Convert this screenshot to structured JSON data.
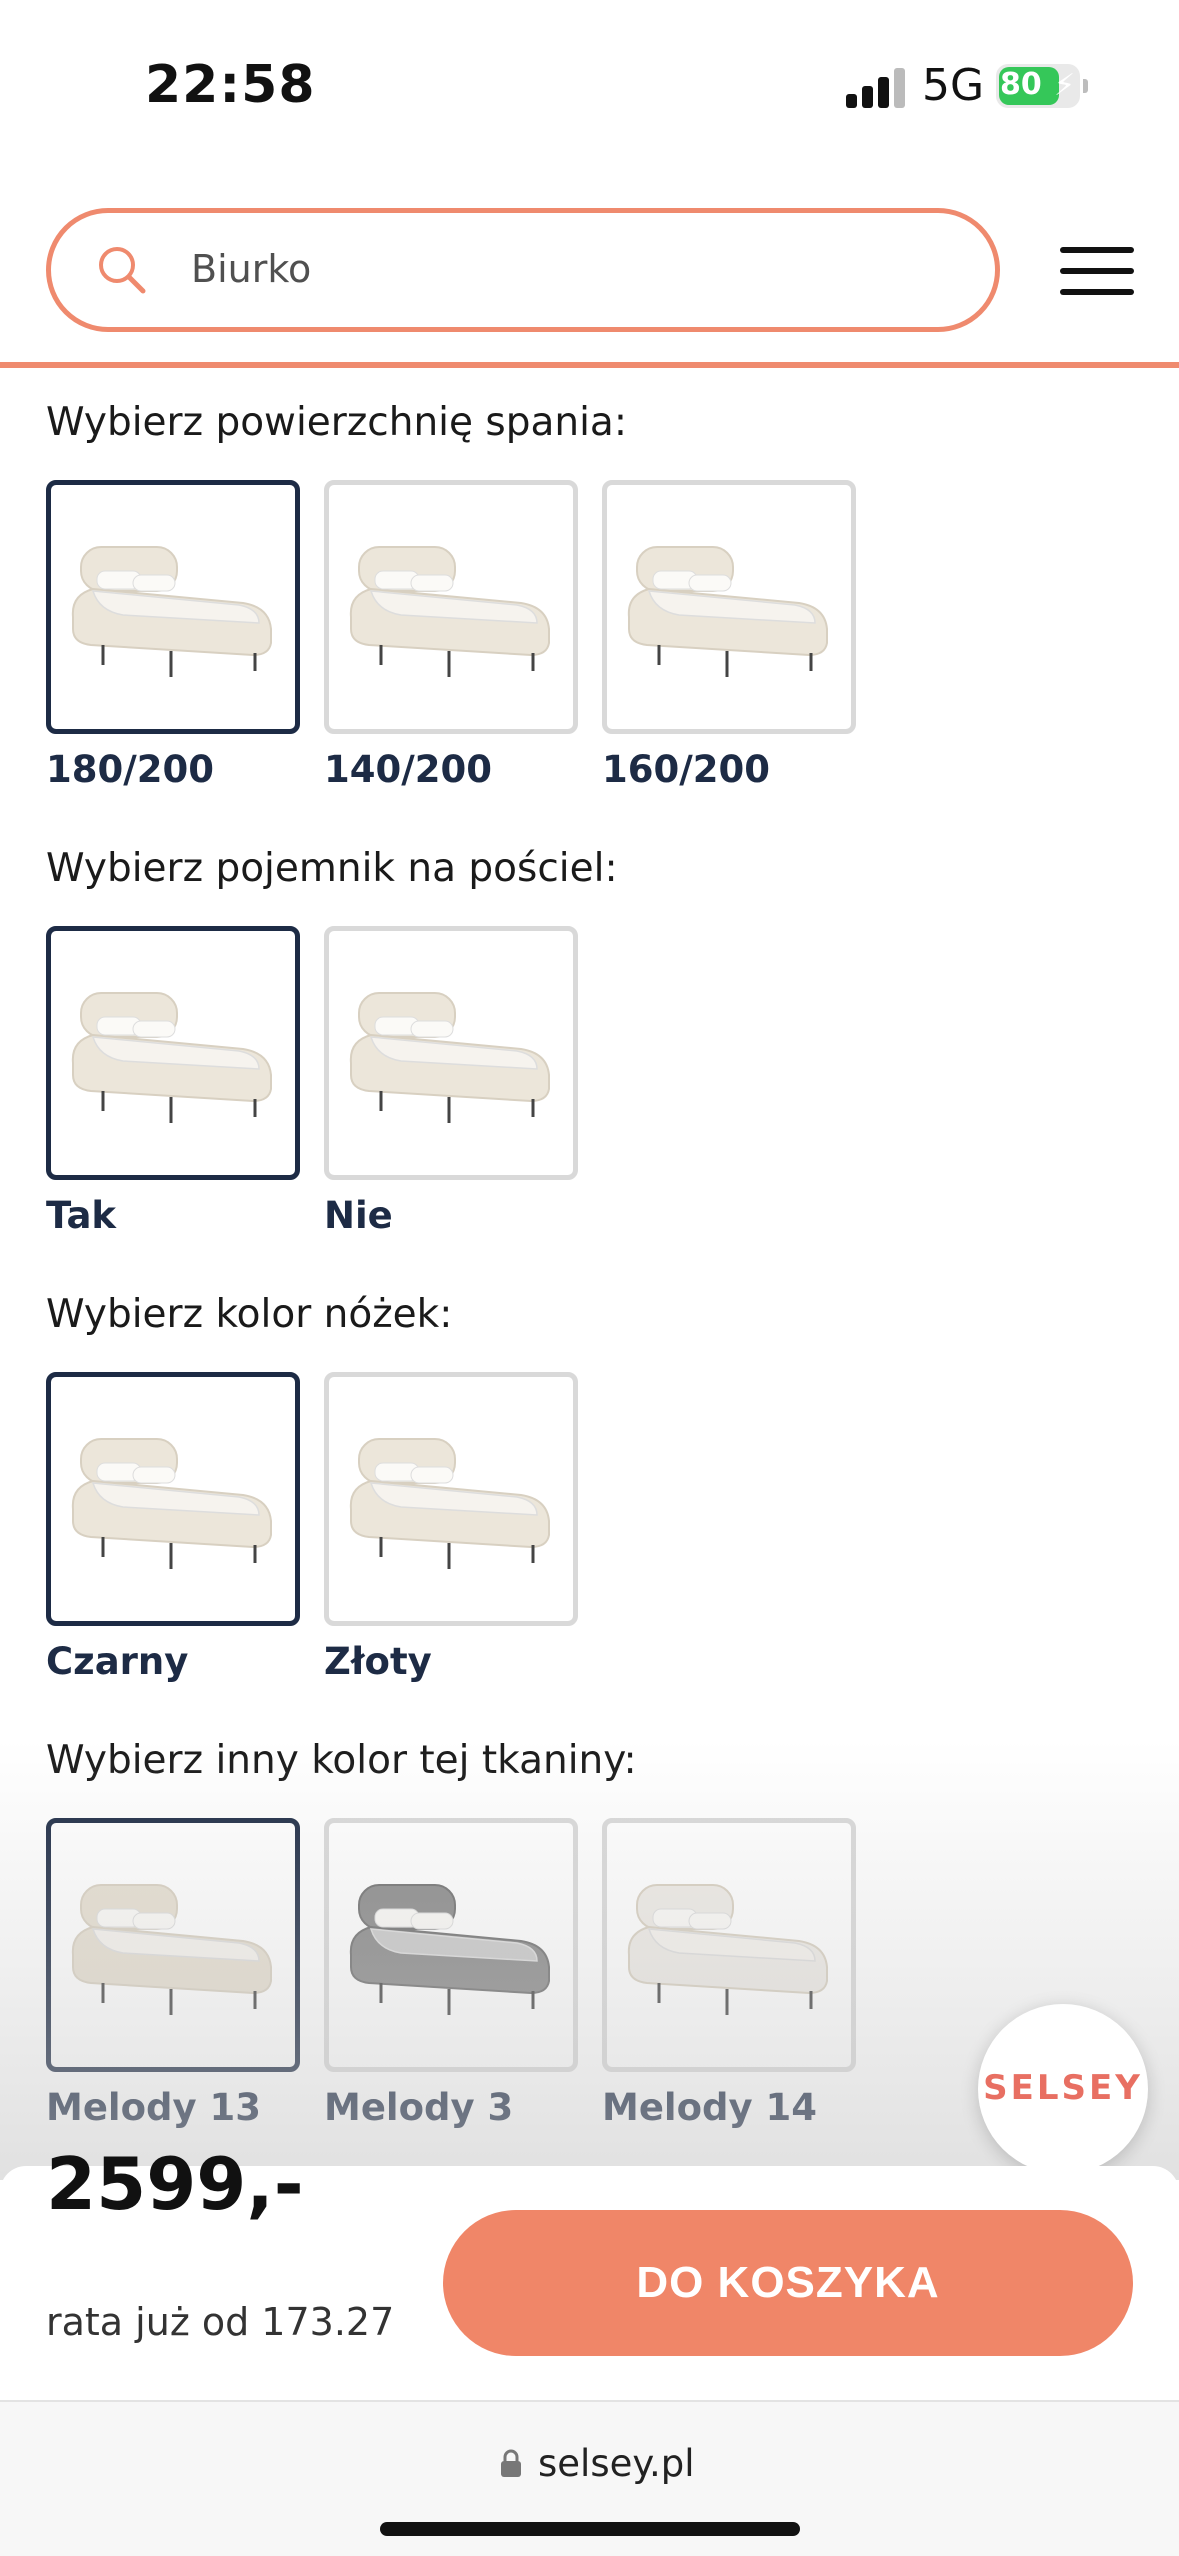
{
  "status": {
    "time": "22:58",
    "network": "5G",
    "battery": "80"
  },
  "header": {
    "search_value": "Biurko",
    "search_icon": "search-icon",
    "menu_icon": "hamburger-menu-icon"
  },
  "sections": [
    {
      "title": "Wybierz powierzchnię spania:",
      "options": [
        {
          "label": "180/200",
          "selected": true,
          "color": "#ece6da"
        },
        {
          "label": "140/200",
          "selected": false,
          "color": "#ece6da"
        },
        {
          "label": "160/200",
          "selected": false,
          "color": "#ece6da"
        }
      ]
    },
    {
      "title": "Wybierz pojemnik na pościel:",
      "options": [
        {
          "label": "Tak",
          "selected": true,
          "color": "#ece6da"
        },
        {
          "label": "Nie",
          "selected": false,
          "color": "#ece6da"
        }
      ]
    },
    {
      "title": "Wybierz kolor nóżek:",
      "options": [
        {
          "label": "Czarny",
          "selected": true,
          "color": "#ece6da"
        },
        {
          "label": "Złoty",
          "selected": false,
          "color": "#ece6da"
        }
      ]
    },
    {
      "title": "Wybierz inny kolor tej tkaniny:",
      "options": [
        {
          "label": "Melody 13",
          "selected": true,
          "color": "#e6dfd1"
        },
        {
          "label": "Melody 3",
          "selected": false,
          "color": "#8a8a8a"
        },
        {
          "label": "Melody 14",
          "selected": false,
          "color": "#eeebe6"
        }
      ]
    }
  ],
  "brand_bubble": "SELSEY",
  "cart": {
    "price": "2599,-",
    "installment": "rata już od 173.27",
    "button_label": "DO KOSZYKA"
  },
  "browser": {
    "url": "selsey.pl"
  },
  "colors": {
    "accent": "#ef8a6e",
    "selected_border": "#1d2b45",
    "label_color": "#1d2b45"
  }
}
